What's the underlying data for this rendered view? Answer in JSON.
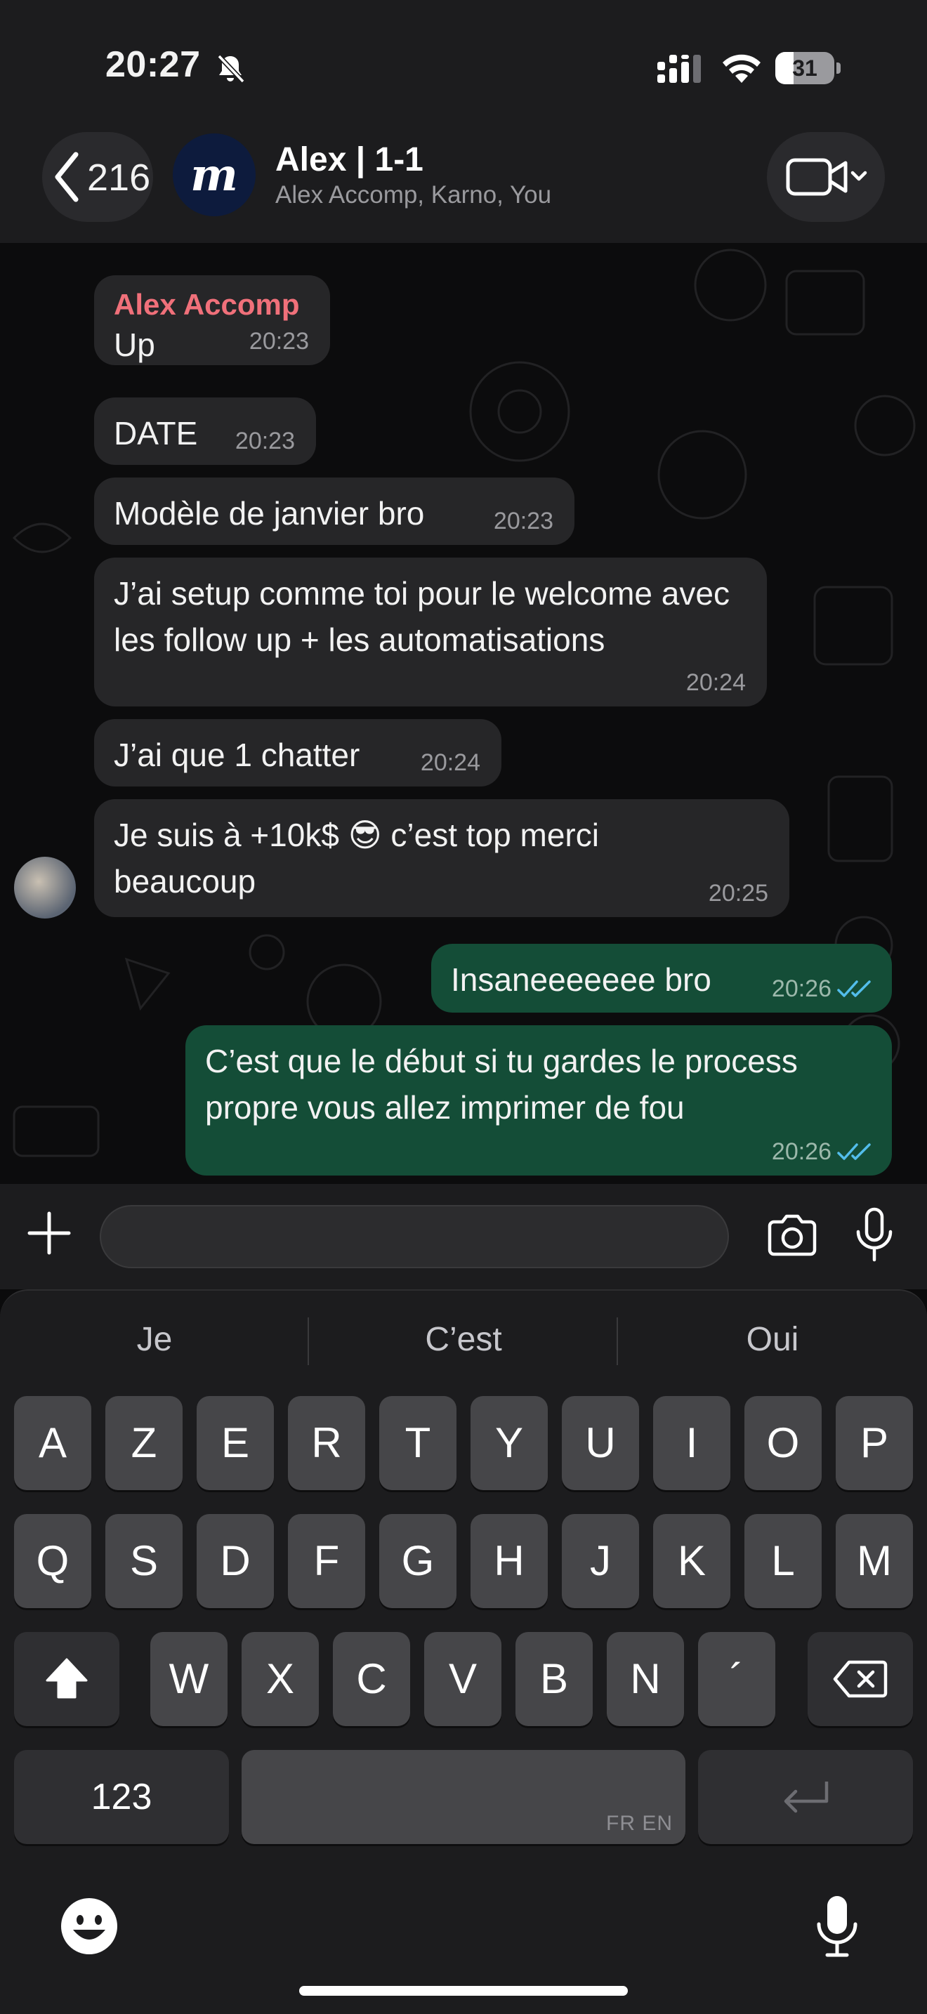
{
  "status_bar": {
    "time": "20:27",
    "battery": "31",
    "battery_level": 0.31,
    "icons": [
      "bell-slash-icon",
      "cellular-signal-icon",
      "wifi-icon",
      "battery-icon"
    ]
  },
  "header": {
    "back_count": "216",
    "avatar_letter": "m",
    "title": "Alex | 1-1",
    "subtitle": "Alex Accomp, Karno, You",
    "icons": [
      "chevron-left-icon",
      "video-call-icon",
      "chevron-down-icon"
    ]
  },
  "messages": [
    {
      "direction": "in",
      "sender": "Alex Accomp",
      "text": "Up",
      "time": "20:23"
    },
    {
      "direction": "in",
      "text": "DATE",
      "time": "20:23"
    },
    {
      "direction": "in",
      "text": "Modèle de janvier bro",
      "time": "20:23"
    },
    {
      "direction": "in",
      "text": "J’ai setup comme toi pour le welcome avec les follow up + les automatisations",
      "time": "20:24"
    },
    {
      "direction": "in",
      "text": "J’ai que 1 chatter",
      "time": "20:24"
    },
    {
      "direction": "in",
      "text": "Je suis à +10k$ 😎 c’est top merci beaucoup",
      "time": "20:25"
    },
    {
      "direction": "out",
      "text": "Insaneeeeeee bro",
      "time": "20:26",
      "status": "read"
    },
    {
      "direction": "out",
      "text": "C’est que le début si tu gardes le process propre vous allez imprimer de fou",
      "time": "20:26",
      "status": "read"
    }
  ],
  "input_bar": {
    "value": "",
    "icons": [
      "plus-icon",
      "sticker-icon",
      "camera-icon",
      "microphone-icon"
    ]
  },
  "keyboard": {
    "suggestions": [
      "Je",
      "C’est",
      "Oui"
    ],
    "row1": [
      "A",
      "Z",
      "E",
      "R",
      "T",
      "Y",
      "U",
      "I",
      "O",
      "P"
    ],
    "row2": [
      "Q",
      "S",
      "D",
      "F",
      "G",
      "H",
      "J",
      "K",
      "L",
      "M"
    ],
    "row3": [
      "W",
      "X",
      "C",
      "V",
      "B",
      "N",
      "´"
    ],
    "numbers_key": "123",
    "space_languages": "FR EN",
    "icons": [
      "shift-icon",
      "backspace-icon",
      "return-icon",
      "emoji-icon",
      "dictation-icon"
    ]
  },
  "colors": {
    "incoming_bubble": "#262628",
    "outgoing_bubble": "#144d37",
    "sender_name": "#f0707a",
    "read_ticks": "#53bdeb",
    "accent_green": "#21c063"
  }
}
